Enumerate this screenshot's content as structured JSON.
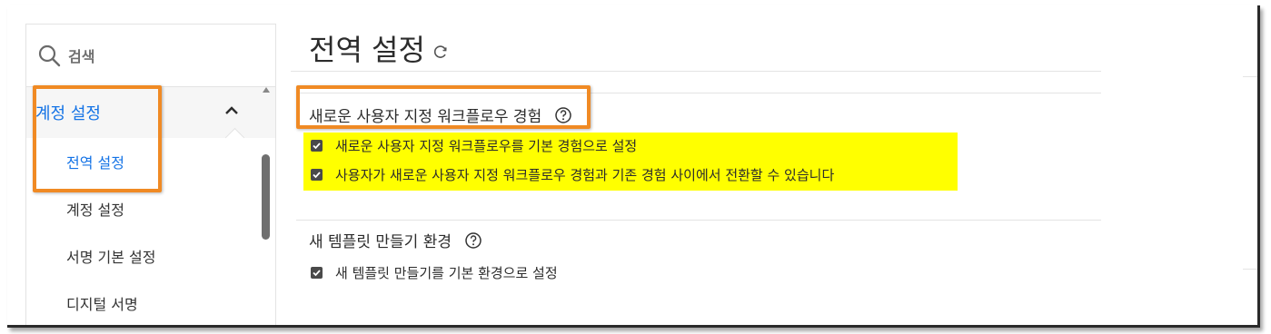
{
  "search": {
    "label": "검색"
  },
  "sidebar": {
    "section_title": "계정 설정",
    "items": [
      {
        "label": "전역 설정",
        "active": true
      },
      {
        "label": "계정 설정",
        "active": false
      },
      {
        "label": "서명 기본 설정",
        "active": false
      },
      {
        "label": "디지털 서명",
        "active": false
      }
    ]
  },
  "main": {
    "title": "전역 설정",
    "sections": [
      {
        "title": "새로운 사용자 지정 워크플로우 경험",
        "options": [
          {
            "label": "새로운 사용자 지정 워크플로우를 기본 경험으로 설정",
            "checked": true
          },
          {
            "label": "사용자가 새로운 사용자 지정 워크플로우 경험과 기존 경험 사이에서 전환할 수 있습니다",
            "checked": true
          }
        ]
      },
      {
        "title": "새 템플릿 만들기 환경",
        "options": [
          {
            "label": "새 템플릿 만들기를 기본 환경으로 설정",
            "checked": true
          }
        ]
      }
    ]
  },
  "colors": {
    "accent": "#1473e6",
    "callout": "#f08a24",
    "highlight": "#ffff00"
  }
}
